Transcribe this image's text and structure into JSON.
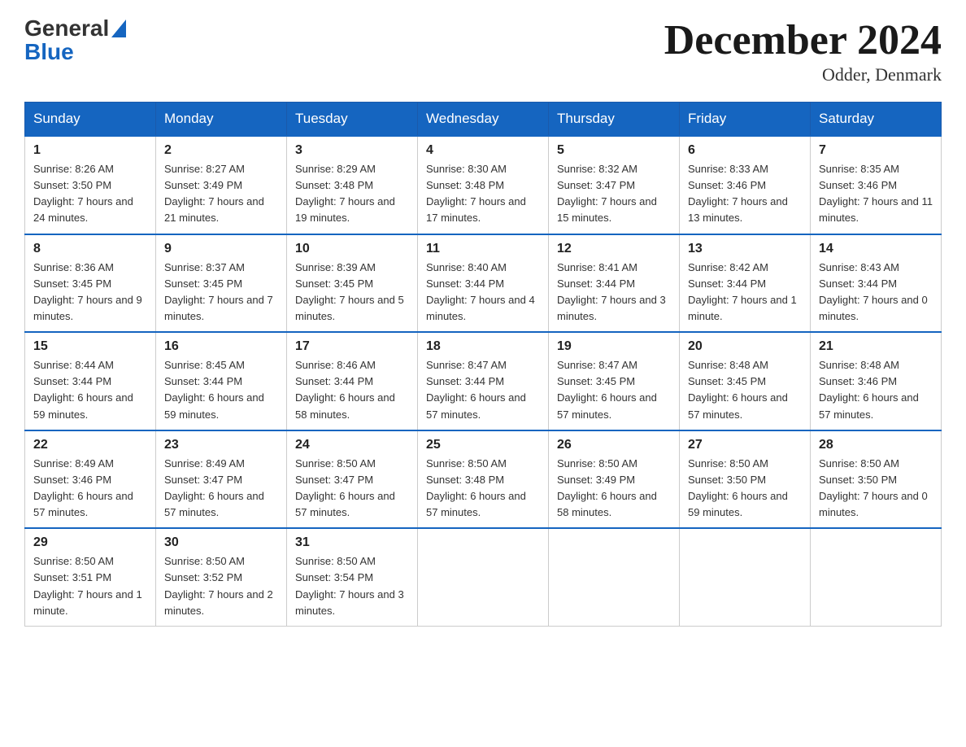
{
  "logo": {
    "general": "General",
    "triangle": "▶",
    "blue": "Blue"
  },
  "title": {
    "month_year": "December 2024",
    "location": "Odder, Denmark"
  },
  "days_of_week": [
    "Sunday",
    "Monday",
    "Tuesday",
    "Wednesday",
    "Thursday",
    "Friday",
    "Saturday"
  ],
  "weeks": [
    [
      {
        "day": "1",
        "sunrise": "8:26 AM",
        "sunset": "3:50 PM",
        "daylight": "7 hours and 24 minutes."
      },
      {
        "day": "2",
        "sunrise": "8:27 AM",
        "sunset": "3:49 PM",
        "daylight": "7 hours and 21 minutes."
      },
      {
        "day": "3",
        "sunrise": "8:29 AM",
        "sunset": "3:48 PM",
        "daylight": "7 hours and 19 minutes."
      },
      {
        "day": "4",
        "sunrise": "8:30 AM",
        "sunset": "3:48 PM",
        "daylight": "7 hours and 17 minutes."
      },
      {
        "day": "5",
        "sunrise": "8:32 AM",
        "sunset": "3:47 PM",
        "daylight": "7 hours and 15 minutes."
      },
      {
        "day": "6",
        "sunrise": "8:33 AM",
        "sunset": "3:46 PM",
        "daylight": "7 hours and 13 minutes."
      },
      {
        "day": "7",
        "sunrise": "8:35 AM",
        "sunset": "3:46 PM",
        "daylight": "7 hours and 11 minutes."
      }
    ],
    [
      {
        "day": "8",
        "sunrise": "8:36 AM",
        "sunset": "3:45 PM",
        "daylight": "7 hours and 9 minutes."
      },
      {
        "day": "9",
        "sunrise": "8:37 AM",
        "sunset": "3:45 PM",
        "daylight": "7 hours and 7 minutes."
      },
      {
        "day": "10",
        "sunrise": "8:39 AM",
        "sunset": "3:45 PM",
        "daylight": "7 hours and 5 minutes."
      },
      {
        "day": "11",
        "sunrise": "8:40 AM",
        "sunset": "3:44 PM",
        "daylight": "7 hours and 4 minutes."
      },
      {
        "day": "12",
        "sunrise": "8:41 AM",
        "sunset": "3:44 PM",
        "daylight": "7 hours and 3 minutes."
      },
      {
        "day": "13",
        "sunrise": "8:42 AM",
        "sunset": "3:44 PM",
        "daylight": "7 hours and 1 minute."
      },
      {
        "day": "14",
        "sunrise": "8:43 AM",
        "sunset": "3:44 PM",
        "daylight": "7 hours and 0 minutes."
      }
    ],
    [
      {
        "day": "15",
        "sunrise": "8:44 AM",
        "sunset": "3:44 PM",
        "daylight": "6 hours and 59 minutes."
      },
      {
        "day": "16",
        "sunrise": "8:45 AM",
        "sunset": "3:44 PM",
        "daylight": "6 hours and 59 minutes."
      },
      {
        "day": "17",
        "sunrise": "8:46 AM",
        "sunset": "3:44 PM",
        "daylight": "6 hours and 58 minutes."
      },
      {
        "day": "18",
        "sunrise": "8:47 AM",
        "sunset": "3:44 PM",
        "daylight": "6 hours and 57 minutes."
      },
      {
        "day": "19",
        "sunrise": "8:47 AM",
        "sunset": "3:45 PM",
        "daylight": "6 hours and 57 minutes."
      },
      {
        "day": "20",
        "sunrise": "8:48 AM",
        "sunset": "3:45 PM",
        "daylight": "6 hours and 57 minutes."
      },
      {
        "day": "21",
        "sunrise": "8:48 AM",
        "sunset": "3:46 PM",
        "daylight": "6 hours and 57 minutes."
      }
    ],
    [
      {
        "day": "22",
        "sunrise": "8:49 AM",
        "sunset": "3:46 PM",
        "daylight": "6 hours and 57 minutes."
      },
      {
        "day": "23",
        "sunrise": "8:49 AM",
        "sunset": "3:47 PM",
        "daylight": "6 hours and 57 minutes."
      },
      {
        "day": "24",
        "sunrise": "8:50 AM",
        "sunset": "3:47 PM",
        "daylight": "6 hours and 57 minutes."
      },
      {
        "day": "25",
        "sunrise": "8:50 AM",
        "sunset": "3:48 PM",
        "daylight": "6 hours and 57 minutes."
      },
      {
        "day": "26",
        "sunrise": "8:50 AM",
        "sunset": "3:49 PM",
        "daylight": "6 hours and 58 minutes."
      },
      {
        "day": "27",
        "sunrise": "8:50 AM",
        "sunset": "3:50 PM",
        "daylight": "6 hours and 59 minutes."
      },
      {
        "day": "28",
        "sunrise": "8:50 AM",
        "sunset": "3:50 PM",
        "daylight": "7 hours and 0 minutes."
      }
    ],
    [
      {
        "day": "29",
        "sunrise": "8:50 AM",
        "sunset": "3:51 PM",
        "daylight": "7 hours and 1 minute."
      },
      {
        "day": "30",
        "sunrise": "8:50 AM",
        "sunset": "3:52 PM",
        "daylight": "7 hours and 2 minutes."
      },
      {
        "day": "31",
        "sunrise": "8:50 AM",
        "sunset": "3:54 PM",
        "daylight": "7 hours and 3 minutes."
      },
      null,
      null,
      null,
      null
    ]
  ],
  "labels": {
    "sunrise": "Sunrise:",
    "sunset": "Sunset:",
    "daylight": "Daylight:"
  }
}
